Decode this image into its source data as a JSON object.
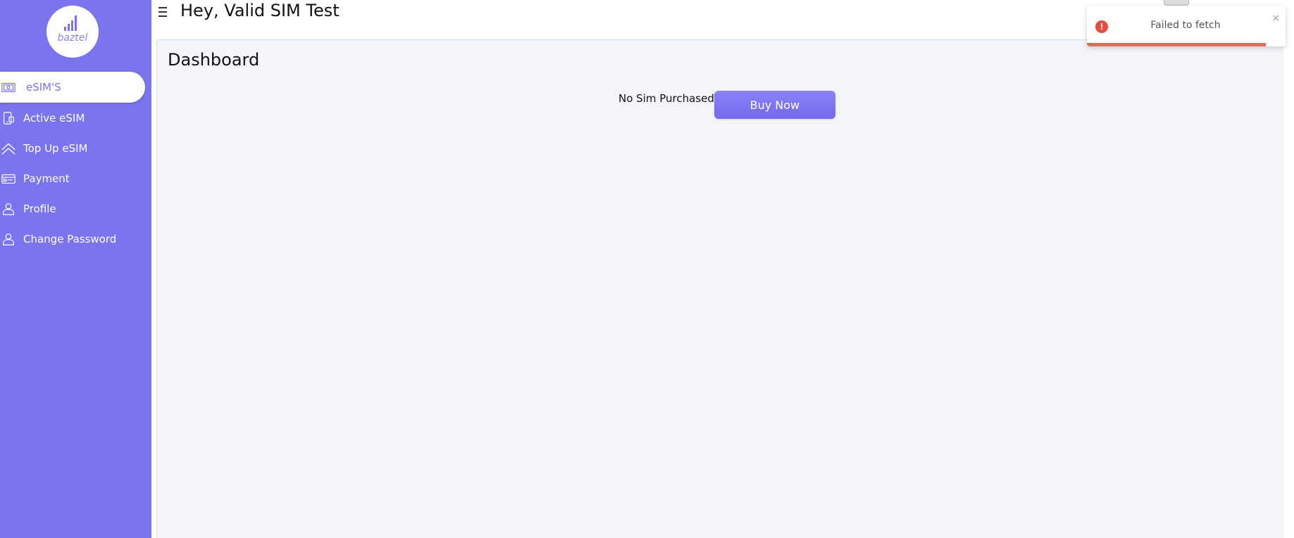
{
  "brand": {
    "logo_text": "baztel",
    "accent_color": "#7b74ef"
  },
  "sidebar": {
    "items": [
      {
        "label": "eSIM'S",
        "icon": "sim-card-icon",
        "active": true
      },
      {
        "label": "Active eSIM",
        "icon": "phone-sim-icon",
        "active": false
      },
      {
        "label": "Top Up eSIM",
        "icon": "double-chevron-up-icon",
        "active": false
      },
      {
        "label": "Payment",
        "icon": "credit-card-icon",
        "active": false
      },
      {
        "label": "Profile",
        "icon": "user-icon",
        "active": false
      },
      {
        "label": "Change Password",
        "icon": "user-icon",
        "active": false
      }
    ]
  },
  "header": {
    "greeting": "Hey, Valid SIM Test",
    "menu_icon": "hamburger-icon"
  },
  "main": {
    "title": "Dashboard",
    "empty_message": "No Sim Purchased",
    "buy_button_label": "Buy Now"
  },
  "toast": {
    "type": "error",
    "message": "Failed to fetch",
    "close_label": "×",
    "icon_glyph": "!",
    "progress": 0.9,
    "color": "#e56b5c"
  }
}
